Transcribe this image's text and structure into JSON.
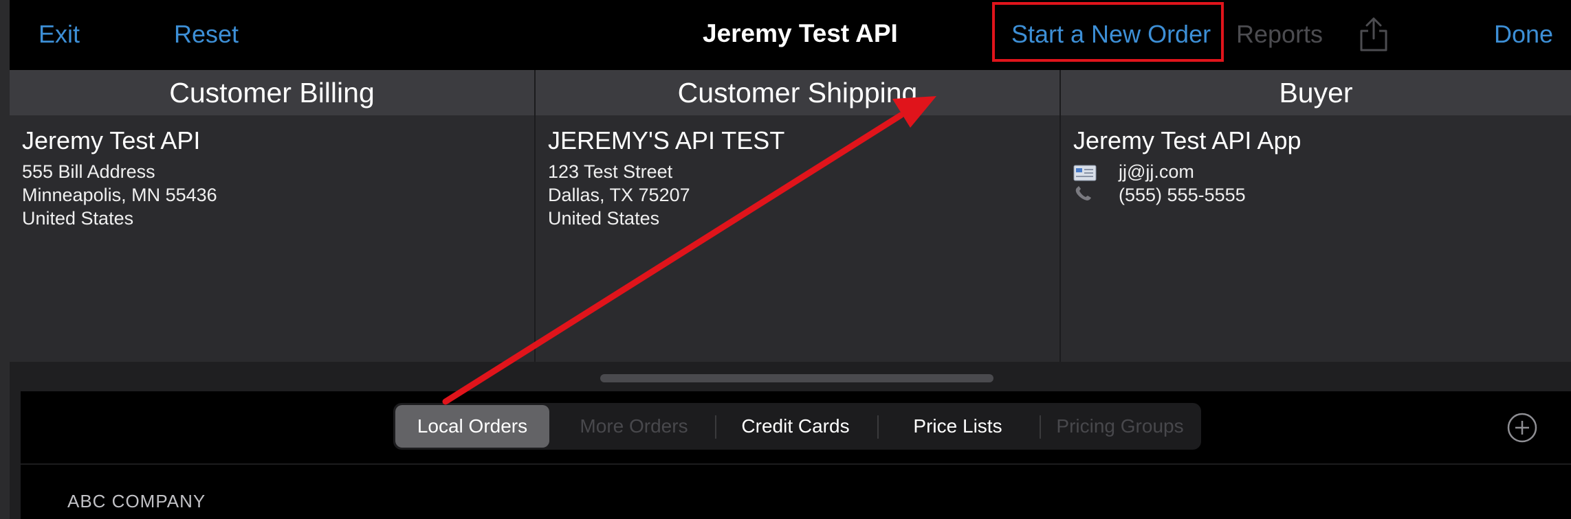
{
  "nav": {
    "exit_label": "Exit",
    "reset_label": "Reset",
    "title": "Jeremy Test API",
    "start_order_label": "Start a New Order",
    "reports_label": "Reports",
    "done_label": "Done"
  },
  "columns": {
    "billing": {
      "header": "Customer Billing",
      "name": "Jeremy Test API",
      "line1": "555 Bill Address",
      "line2": "Minneapolis, MN  55436",
      "line3": "United States"
    },
    "shipping": {
      "header": "Customer Shipping",
      "name": "JEREMY'S API TEST",
      "line1": "123 Test Street",
      "line2": "Dallas, TX  75207",
      "line3": "United States"
    },
    "buyer": {
      "header": "Buyer",
      "name": "Jeremy Test API App",
      "email": "jj@jj.com",
      "phone": "(555) 555-5555"
    }
  },
  "segments": {
    "local_orders": "Local Orders",
    "more_orders": "More Orders",
    "credit_cards": "Credit Cards",
    "price_lists": "Price Lists",
    "pricing_groups": "Pricing Groups"
  },
  "list": {
    "first_item": "ABC COMPANY"
  },
  "colors": {
    "accent_blue": "#3d8fd6",
    "highlight_red": "#e0141b",
    "background": "#1f1f21"
  },
  "icons": [
    "share-icon",
    "email-icon",
    "phone-icon",
    "add-circle-icon"
  ]
}
